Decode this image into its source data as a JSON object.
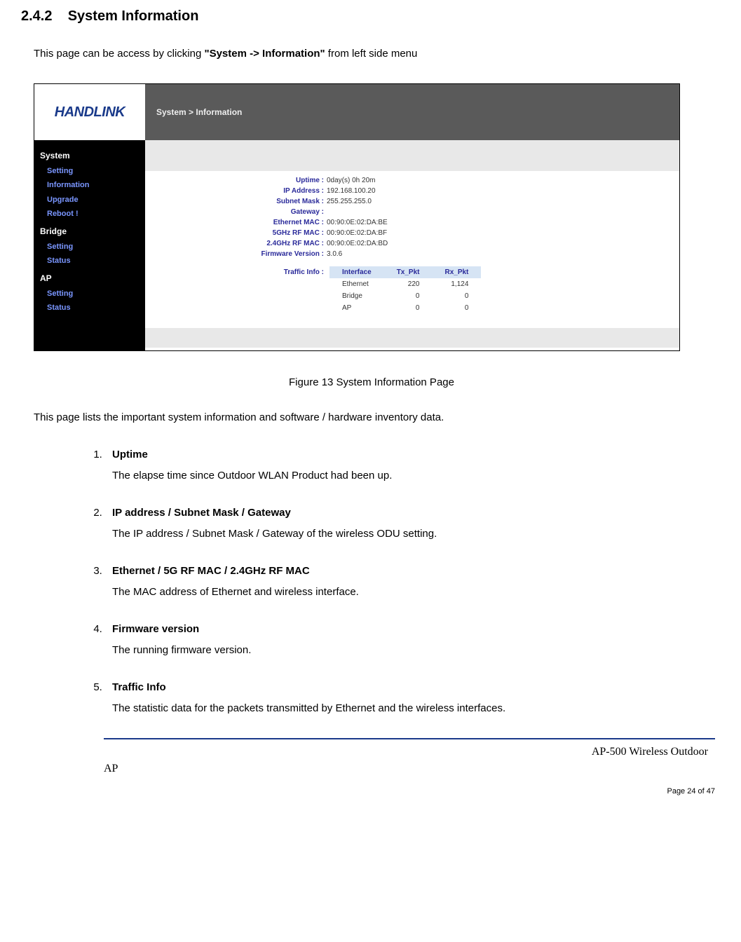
{
  "section": {
    "number": "2.4.2",
    "title": "System Information"
  },
  "intro": {
    "pre": "This page can be access by clicking ",
    "bold": "\"System -> Information\"",
    "post": " from left side menu"
  },
  "screenshot": {
    "logo": "HANDLINK",
    "breadcrumb": "System > Information",
    "nav": {
      "system": {
        "head": "System",
        "items": [
          "Setting",
          "Information",
          "Upgrade",
          "Reboot !"
        ]
      },
      "bridge": {
        "head": "Bridge",
        "items": [
          "Setting",
          "Status"
        ]
      },
      "ap": {
        "head": "AP",
        "items": [
          "Setting",
          "Status"
        ]
      }
    },
    "info": {
      "uptime": {
        "label": "Uptime :",
        "value": "0day(s) 0h 20m"
      },
      "ip": {
        "label": "IP Address :",
        "value": "192.168.100.20"
      },
      "mask": {
        "label": "Subnet Mask :",
        "value": "255.255.255.0"
      },
      "gateway": {
        "label": "Gateway :",
        "value": ""
      },
      "eth_mac": {
        "label": "Ethernet MAC :",
        "value": "00:90:0E:02:DA:BE"
      },
      "mac5g": {
        "label": "5GHz RF MAC :",
        "value": "00:90:0E:02:DA:BF"
      },
      "mac24g": {
        "label": "2.4GHz RF MAC :",
        "value": "00:90:0E:02:DA:BD"
      },
      "fw": {
        "label": "Firmware Version :",
        "value": "3.0.6"
      }
    },
    "traffic": {
      "label": "Traffic Info :",
      "headers": {
        "iface": "Interface",
        "tx": "Tx_Pkt",
        "rx": "Rx_Pkt"
      },
      "rows": [
        {
          "iface": "Ethernet",
          "tx": "220",
          "rx": "1,124"
        },
        {
          "iface": "Bridge",
          "tx": "0",
          "rx": "0"
        },
        {
          "iface": "AP",
          "tx": "0",
          "rx": "0"
        }
      ]
    }
  },
  "caption": "Figure 13    System Information Page",
  "desc2": "This page lists the important system information and software / hardware inventory data.",
  "list": [
    {
      "term": "Uptime",
      "body": "The elapse time since Outdoor WLAN Product had been up."
    },
    {
      "term": "IP address / Subnet Mask / Gateway",
      "body": "The IP address / Subnet Mask / Gateway of the wireless ODU setting."
    },
    {
      "term": "Ethernet / 5G RF MAC / 2.4GHz RF MAC",
      "body": "The MAC address of Ethernet and wireless interface."
    },
    {
      "term": "Firmware version",
      "body": "The running firmware version."
    },
    {
      "term": "Traffic Info",
      "body": "The statistic data for the packets transmitted by Ethernet and the wireless interfaces."
    }
  ],
  "footer": {
    "title": "AP-500    Wireless  Outdoor",
    "ap": "AP",
    "page": "Page 24 of 47"
  }
}
